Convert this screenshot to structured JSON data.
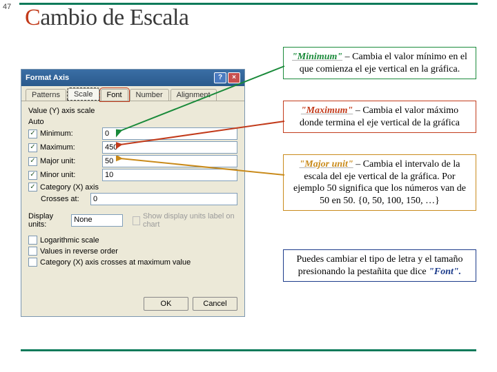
{
  "slide_number": "47",
  "title": "Cambio de Escala",
  "dialog": {
    "title": "Format Axis",
    "tabs": [
      "Patterns",
      "Scale",
      "Font",
      "Number",
      "Alignment"
    ],
    "section": "Value (Y) axis scale",
    "auto": "Auto",
    "rows": {
      "minimum": {
        "label": "Minimum:",
        "value": "0",
        "checked": true
      },
      "maximum": {
        "label": "Maximum:",
        "value": "450",
        "checked": true
      },
      "major": {
        "label": "Major unit:",
        "value": "50",
        "checked": true
      },
      "minor": {
        "label": "Minor unit:",
        "value": "10",
        "checked": true
      },
      "category": {
        "label": "Category (X) axis",
        "checked": true
      },
      "crosses": {
        "label": "Crosses at:",
        "value": "0"
      }
    },
    "display_units_label": "Display units:",
    "display_units_value": "None",
    "show_label_chk": "Show display units label on chart",
    "lower": {
      "log": "Logarithmic scale",
      "rev": "Values in reverse order",
      "catmax": "Category (X) axis crosses at maximum value"
    },
    "ok": "OK",
    "cancel": "Cancel"
  },
  "callouts": {
    "c1": {
      "kw": "\"Minimum\"",
      "text": " – Cambia el valor mínimo en el que comienza el eje vertical en la gráfica."
    },
    "c2": {
      "kw": "\"Maximum\"",
      "text": " – Cambia el valor máximo donde termina el eje vertical de la gráfica"
    },
    "c3": {
      "kw": "\"Major unit\"",
      "text": " – Cambia el intervalo de la escala del eje vertical de la gráfica.  Por ejemplo 50 significa que los números van de 50 en 50. {0, 50, 100, 150, …}"
    },
    "c4": {
      "pre": "Puedes cambiar el tipo de letra y el tamaño presionando la pestañita que dice ",
      "kw": "\"Font\"."
    }
  }
}
